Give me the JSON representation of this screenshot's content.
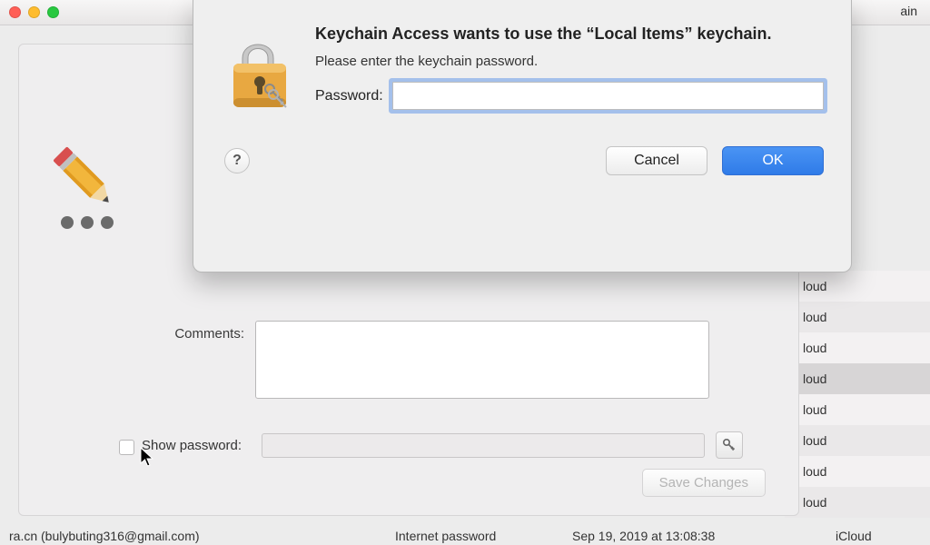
{
  "title_tail": "ain",
  "bg_list": {
    "label": "loud",
    "rows": 8,
    "selected_index": 3
  },
  "bottom_row": {
    "col1": "ra.cn (bulybuting316@gmail.com)",
    "col2": "Internet password",
    "col3": "Sep 19, 2019 at 13:08:38",
    "col4": "iCloud"
  },
  "info_panel": {
    "comments_label": "Comments:",
    "show_password_label": "Show password:",
    "save_button": "Save Changes"
  },
  "modal": {
    "title": "Keychain Access wants to use the “Local Items” keychain.",
    "subtitle": "Please enter the keychain password.",
    "password_label": "Password:",
    "password_value": "",
    "help_label": "?",
    "cancel_label": "Cancel",
    "ok_label": "OK"
  },
  "icons": {
    "padlock": "padlock-icon",
    "pencil": "pencil-icon",
    "key": "key-icon",
    "help": "help-icon"
  }
}
